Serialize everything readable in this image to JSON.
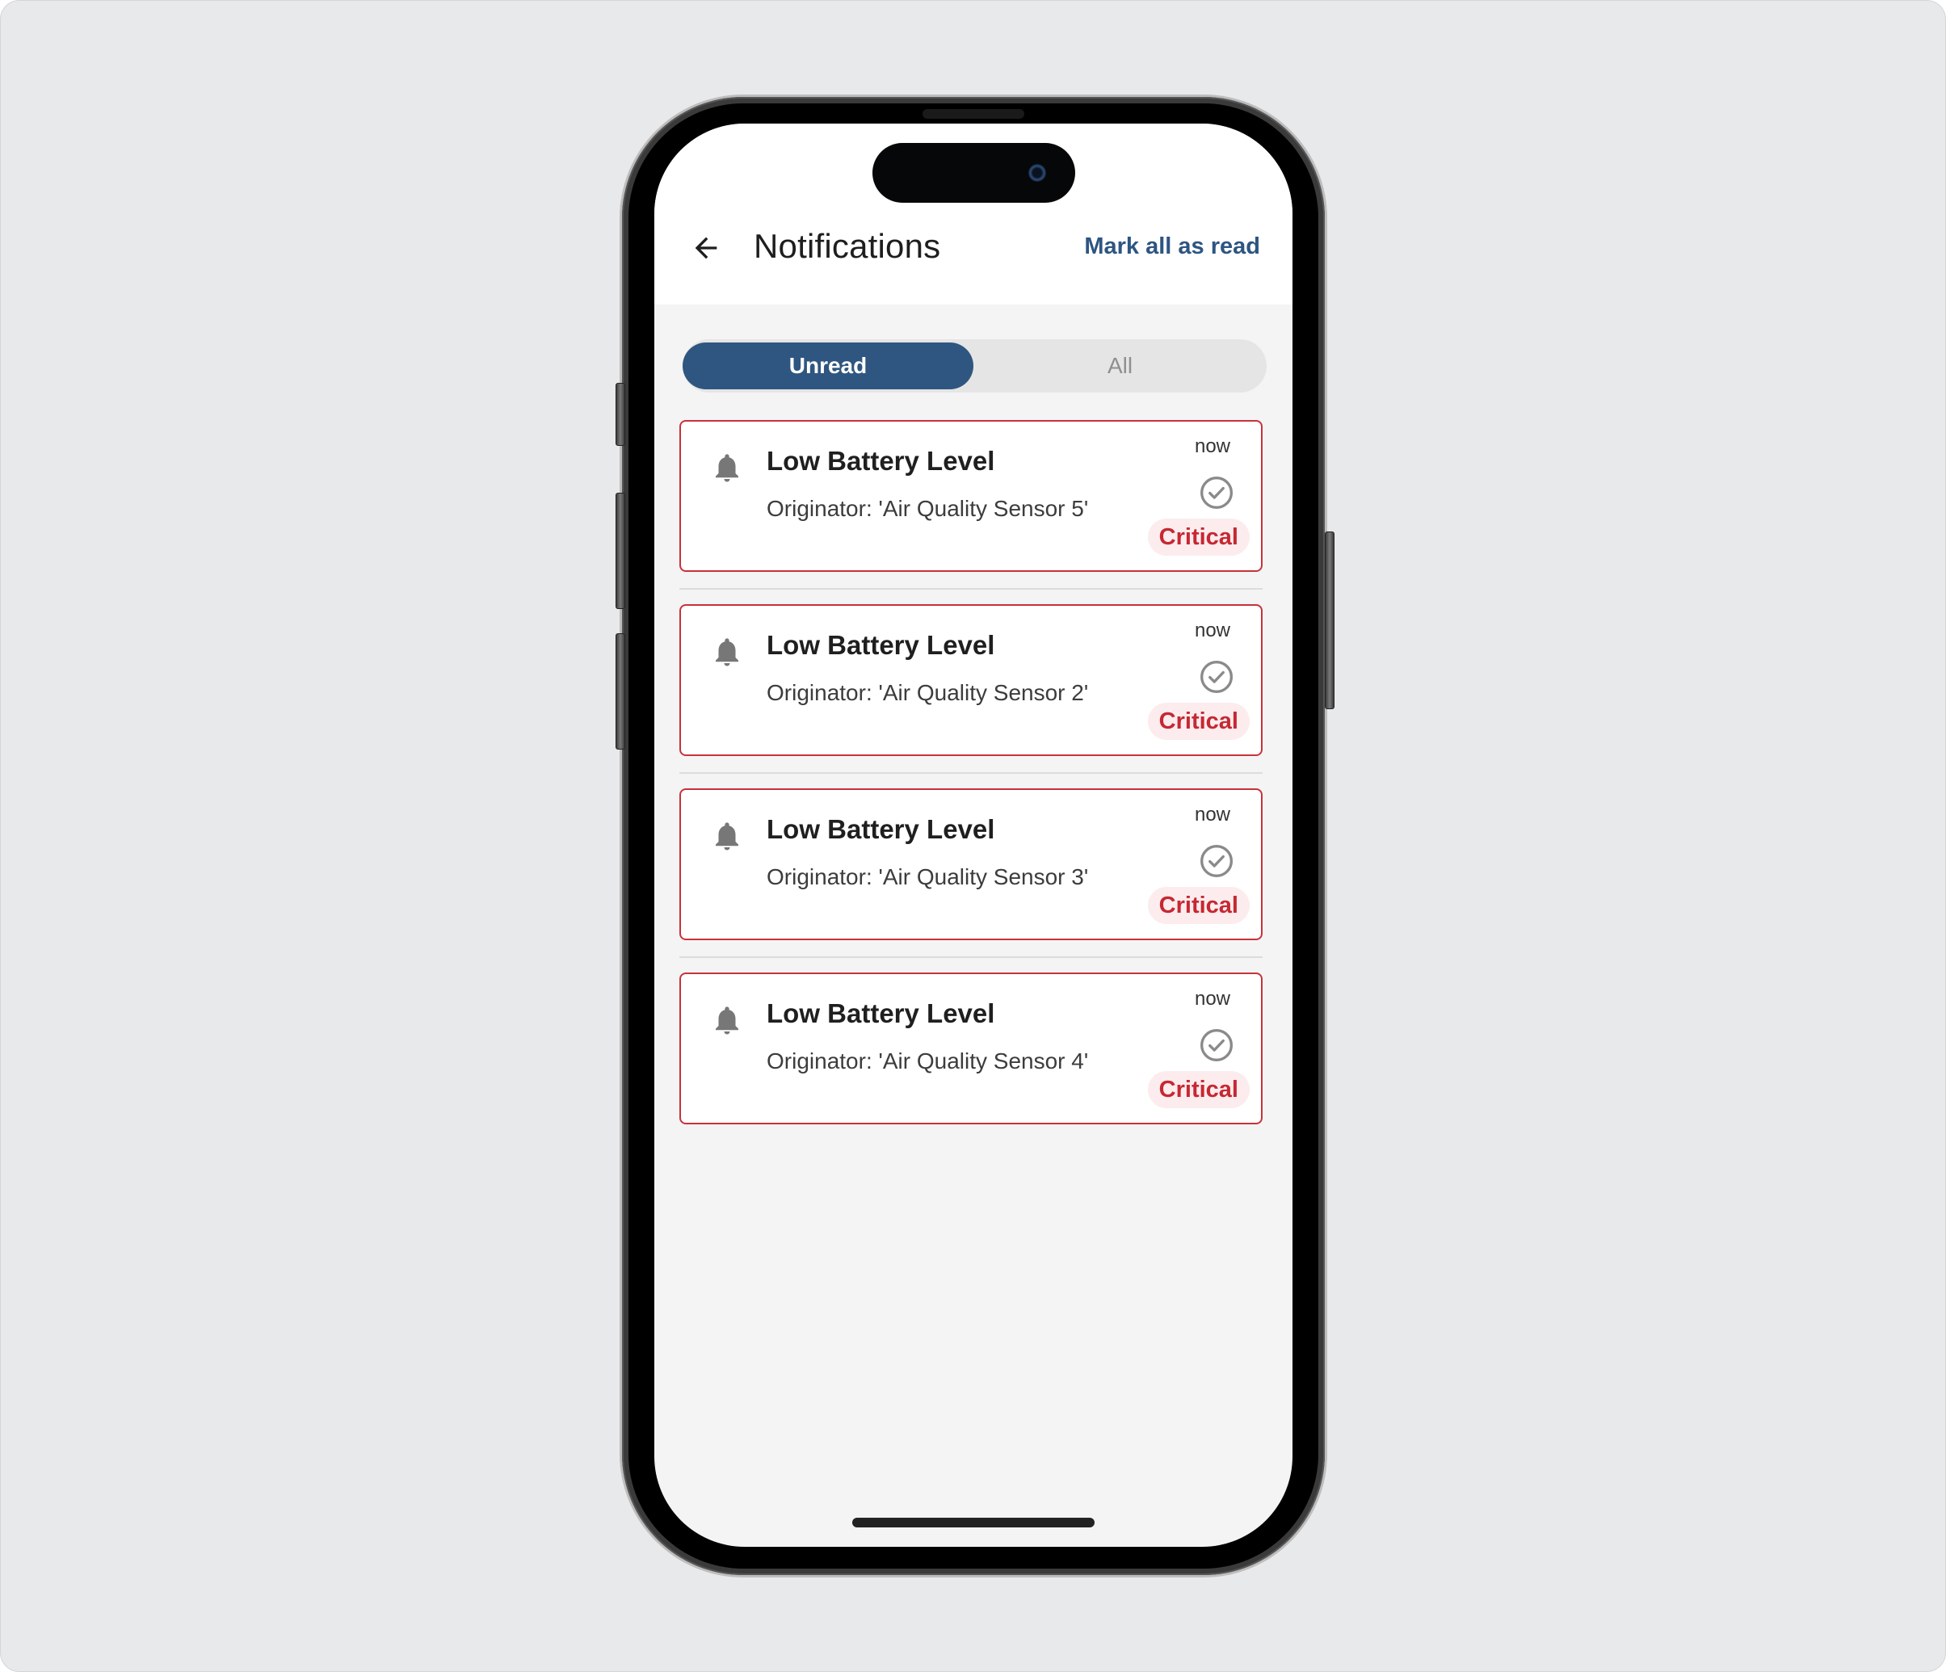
{
  "header": {
    "title": "Notifications",
    "mark_all_label": "Mark all as read",
    "back_icon": "arrow-left-icon"
  },
  "tabs": [
    {
      "label": "Unread",
      "active": true
    },
    {
      "label": "All",
      "active": false
    }
  ],
  "notifications": [
    {
      "title": "Low Battery Level",
      "subtitle": "Originator: 'Air Quality Sensor 5'",
      "time": "now",
      "severity": "Critical",
      "icon": "bell-icon",
      "action_icon": "check-circle-icon"
    },
    {
      "title": "Low Battery Level",
      "subtitle": "Originator: 'Air Quality Sensor 2'",
      "time": "now",
      "severity": "Critical",
      "icon": "bell-icon",
      "action_icon": "check-circle-icon"
    },
    {
      "title": "Low Battery Level",
      "subtitle": "Originator: 'Air Quality Sensor 3'",
      "time": "now",
      "severity": "Critical",
      "icon": "bell-icon",
      "action_icon": "check-circle-icon"
    },
    {
      "title": "Low Battery Level",
      "subtitle": "Originator: 'Air Quality Sensor 4'",
      "time": "now",
      "severity": "Critical",
      "icon": "bell-icon",
      "action_icon": "check-circle-icon"
    }
  ],
  "colors": {
    "accent": "#2f5680",
    "critical": "#c62832",
    "critical_bg": "#fcecee",
    "card_border": "#c8323a"
  }
}
